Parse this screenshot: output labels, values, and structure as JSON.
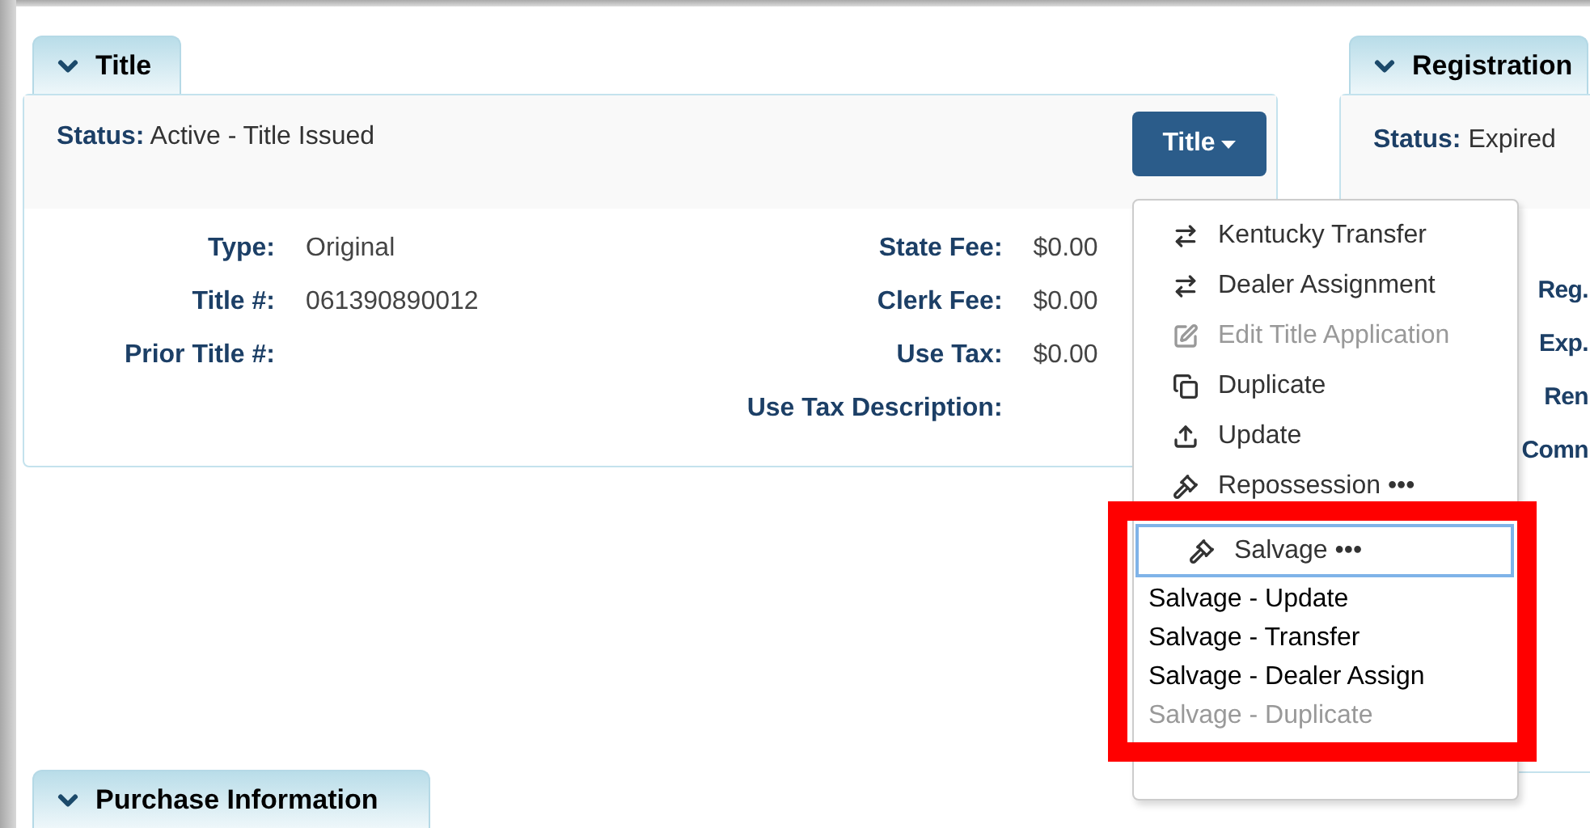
{
  "title_panel": {
    "tab": "Title",
    "expanded": true,
    "status_label": "Status:",
    "status_value": "Active - Title Issued",
    "action_button": "Title",
    "fields_left": [
      {
        "label": "Type:",
        "value": "Original"
      },
      {
        "label": "Title #:",
        "value": "061390890012"
      },
      {
        "label": "Prior Title #:"
      }
    ],
    "fields_right": [
      {
        "label": "State Fee:",
        "value": "$0.00"
      },
      {
        "label": "Clerk Fee:",
        "value": "$0.00"
      },
      {
        "label": "Use Tax:",
        "value": "$0.00"
      },
      {
        "label": "Use Tax Description:"
      }
    ]
  },
  "title_menu": {
    "items": [
      {
        "label": "Kentucky Transfer",
        "kind": "transfer",
        "disabled": false,
        "selected": false
      },
      {
        "label": "Dealer Assignment",
        "kind": "transfer",
        "disabled": false,
        "selected": false
      },
      {
        "label": "Edit Title Application",
        "kind": "edit",
        "disabled": true,
        "selected": false
      },
      {
        "label": "Duplicate",
        "kind": "duplicate",
        "disabled": false,
        "selected": false
      },
      {
        "label": "Update",
        "kind": "update",
        "disabled": false,
        "selected": false
      },
      {
        "label": "Repossession",
        "kind": "gavel",
        "more": "•••",
        "disabled": false,
        "selected": false
      },
      {
        "label": "Salvage",
        "kind": "gavel",
        "more": "•••",
        "disabled": false,
        "selected": true,
        "submenu": [
          {
            "label": "Salvage - Update",
            "disabled": false
          },
          {
            "label": "Salvage - Transfer",
            "disabled": false
          },
          {
            "label": "Salvage - Dealer Assign",
            "disabled": false
          },
          {
            "label": "Salvage - Duplicate",
            "disabled": true
          }
        ]
      }
    ]
  },
  "registration_panel": {
    "tab": "Registration",
    "expanded": true,
    "status_label": "Status:",
    "status_value": "Expired",
    "field_labels": [
      "Reg.",
      "Exp.",
      "Ren",
      "Comn"
    ]
  },
  "purchase_panel": {
    "tab": "Purchase Information",
    "expanded": true
  }
}
